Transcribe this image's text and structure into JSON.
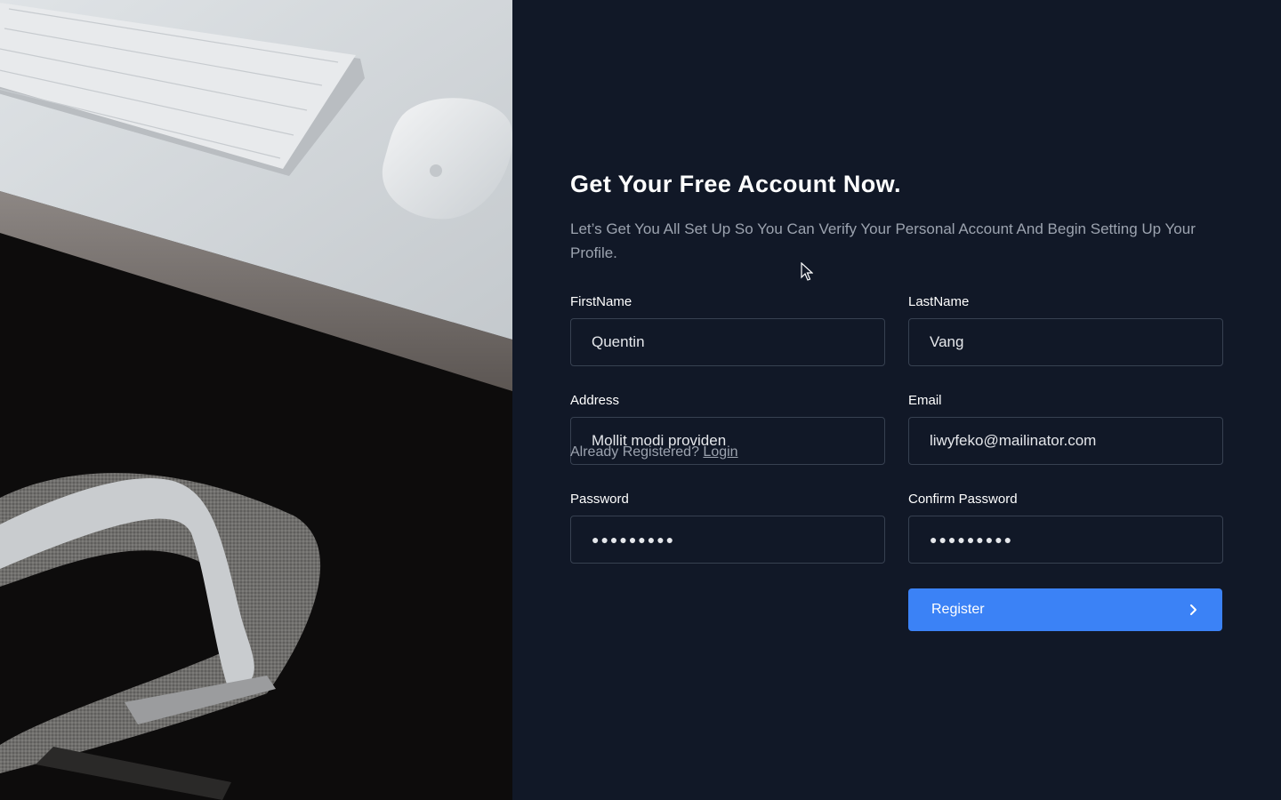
{
  "form": {
    "title": "Get Your Free Account Now.",
    "subtitle": "Let’s Get You All Set Up So You Can Verify Your Personal Account And Begin Setting Up Your Profile.",
    "fields": {
      "first_name": {
        "label": "FirstName",
        "value": "Quentin"
      },
      "last_name": {
        "label": "LastName",
        "value": "Vang"
      },
      "address": {
        "label": "Address",
        "value": "Mollit modi providen"
      },
      "email": {
        "label": "Email",
        "value": "liwyfeko@mailinator.com"
      },
      "password": {
        "label": "Password",
        "value": "●●●●●●●●●"
      },
      "confirm_password": {
        "label": "Confirm Password",
        "value": "●●●●●●●●●"
      }
    },
    "already_registered": "Already Registered?",
    "login_link": "Login",
    "register_button": "Register",
    "register_icon": "chevron-right-icon"
  },
  "colors": {
    "background": "#111827",
    "accent": "#3b82f6",
    "input_border": "#374151",
    "muted_text": "#9ca3af"
  }
}
